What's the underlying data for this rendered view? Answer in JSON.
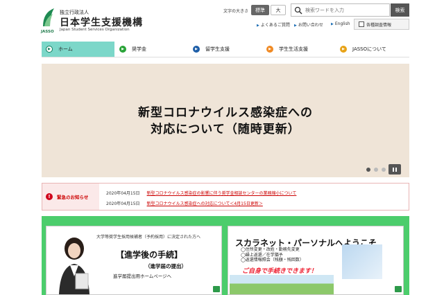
{
  "header": {
    "logo": {
      "sub": "独立行政法人",
      "main": "日本学生支援機構",
      "en": "Japan Student Services Organization",
      "abbr": "JASSO"
    },
    "font_size": {
      "label": "文字の大きさ",
      "standard": "標準",
      "large": "大"
    },
    "search": {
      "placeholder": "検索ワードを入力",
      "button": "検索"
    },
    "links": {
      "faq": "よくあるご質問",
      "contact": "お問い合わせ",
      "english": "English",
      "reports": "各種調査情報"
    }
  },
  "nav": {
    "items": [
      {
        "label": "ホーム",
        "color": "#0b7a5a"
      },
      {
        "label": "奨学金",
        "color": "#2aa338"
      },
      {
        "label": "留学生支援",
        "color": "#1f5fa8"
      },
      {
        "label": "学生生活支援",
        "color": "#f08a24"
      },
      {
        "label": "JASSOについて",
        "color": "#e8a317"
      }
    ]
  },
  "hero": {
    "line1": "新型コロナウイルス感染症への",
    "line2": "対応について（随時更新）"
  },
  "emergency": {
    "label": "緊急のお知らせ",
    "items": [
      {
        "date": "2020年04月15日",
        "text": "新型コロナウイルス感染症の影響に伴う奨学金相談センターの業務縮小について"
      },
      {
        "date": "2020年04月15日",
        "text": "新型コロナウイルス感染症への対応について＜4月15日更新＞"
      }
    ]
  },
  "banners": {
    "left": {
      "small": "大学等奨学生採用候補者（予約採用）に決定された方へ",
      "title": "【進学後の手続】",
      "subtitle": "（進学届の提出）",
      "link": "進学届提出用ホームページへ"
    },
    "right": {
      "title": "スカラネット・パーソナルへようこそ",
      "list": [
        "◯住所変更・改姓・勤務先変更",
        "◯繰上返還／在学猶予",
        "◯返還情報照会（残額・残回数）"
      ],
      "cta": "ご自身で手続きできます！"
    }
  }
}
